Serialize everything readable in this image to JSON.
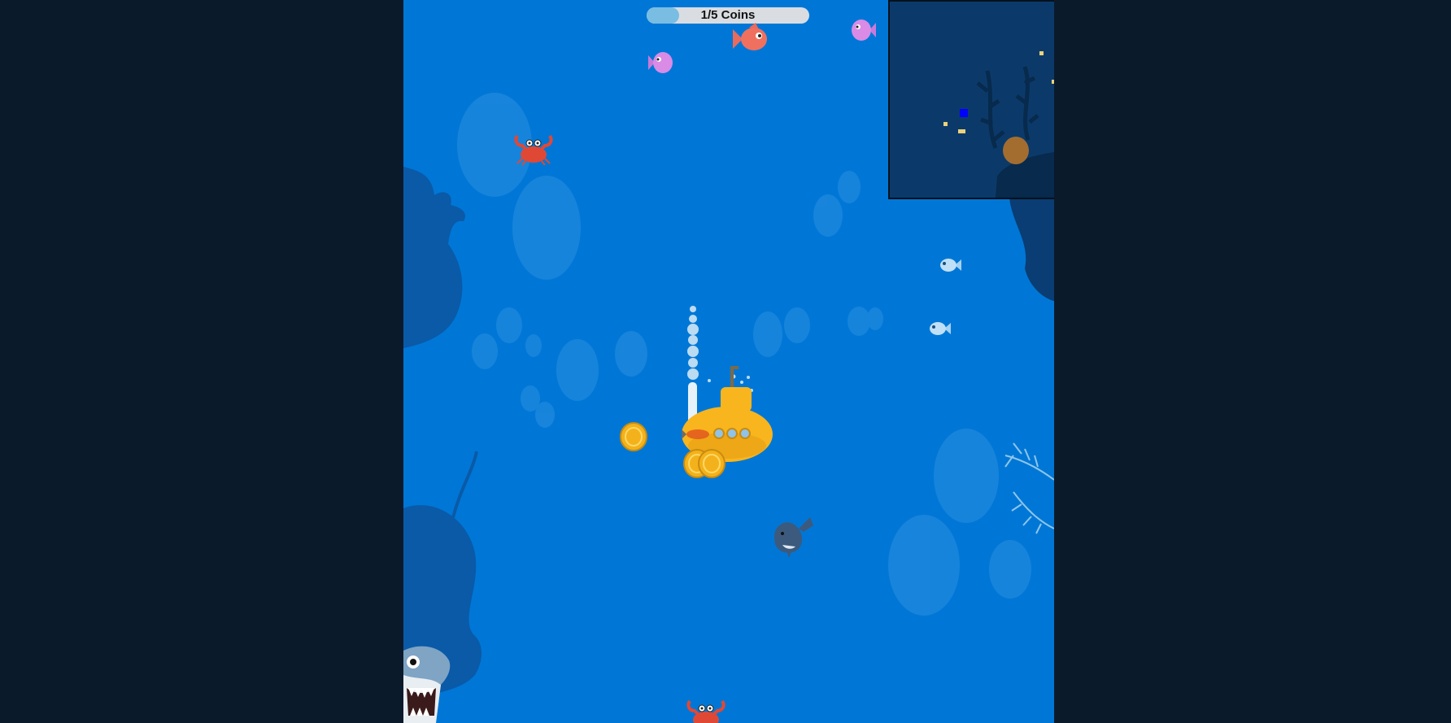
{
  "hud": {
    "coins_collected": 1,
    "coins_total": 5,
    "progress_label": "1/5 Coins"
  },
  "colors": {
    "page_background": "#0b1a2b",
    "water": "#0077d6",
    "silhouette": "#0a5aa8",
    "minimap_background": "#0b3a6a",
    "player_marker": "#0000ff",
    "coin_marker": "#ecd27a",
    "submarine": "#f8b51d",
    "coin": "#f3b21b"
  },
  "icons": [
    "submarine-icon",
    "coin-icon",
    "crab-icon",
    "red-fish-icon",
    "pink-fish-icon",
    "small-blue-fish-icon",
    "whale-icon",
    "shark-icon",
    "seaweed-icon",
    "coral-icon",
    "bubble-icon"
  ]
}
